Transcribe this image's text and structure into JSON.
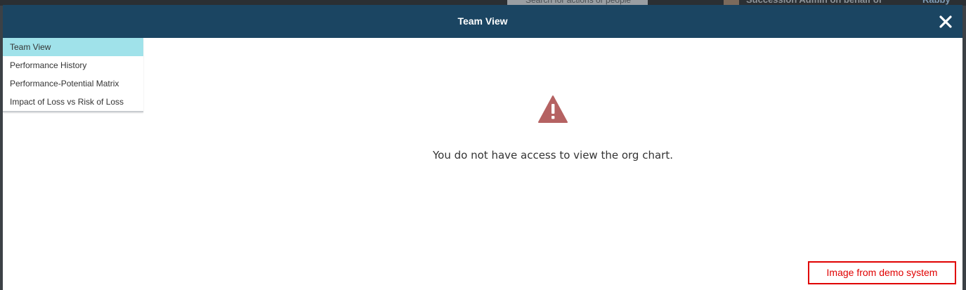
{
  "background": {
    "search_placeholder": "Search for actions or people",
    "user_name": "Succession Admin on behalf of",
    "user_name_right": "Rabby"
  },
  "modal": {
    "title": "Team View",
    "close_icon": "close-icon",
    "header_color": "#1b4562"
  },
  "sidebar": {
    "items": [
      {
        "label": "Team View",
        "active": true
      },
      {
        "label": "Performance History",
        "active": false
      },
      {
        "label": "Performance-Potential Matrix",
        "active": false
      },
      {
        "label": "Impact of Loss vs Risk of Loss",
        "active": false
      }
    ],
    "active_color": "#a0e2ea"
  },
  "main": {
    "icon": "warning-triangle-icon",
    "icon_color": "#b56262",
    "message": "You do not have access to view the org chart."
  },
  "watermark": {
    "text": "Image from demo system",
    "color": "#e00000"
  }
}
